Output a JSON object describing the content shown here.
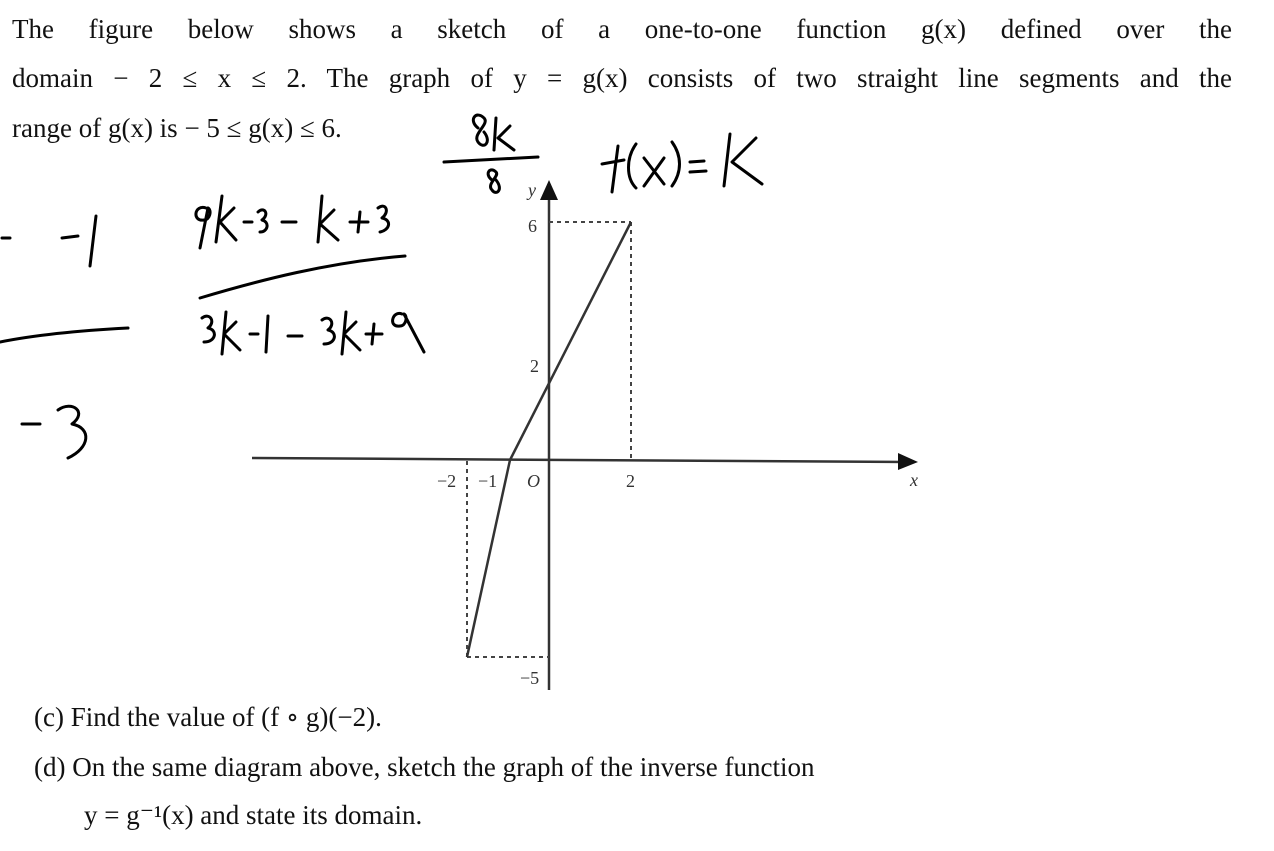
{
  "problem": {
    "intro_line1": "The figure below shows a sketch of a one-to-one function g(x) defined over the",
    "intro_line2": "domain − 2 ≤ x ≤ 2. The graph of y = g(x) consists of two straight line segments and the",
    "intro_line3": "range of g(x) is − 5 ≤ g(x) ≤ 6.",
    "part_c": "(c) Find the value of (f ∘ g)(−2).",
    "part_d_line1": "(d) On the same diagram above, sketch the graph of the inverse function",
    "part_d_line2": "y = g⁻¹(x) and state its domain."
  },
  "figure": {
    "x_axis_label": "x",
    "y_axis_label": "y",
    "origin_label": "O",
    "x_ticks": [
      "−2",
      "−1",
      "2"
    ],
    "y_ticks": [
      "6",
      "2",
      "−5"
    ],
    "segments": [
      {
        "from": [
          -2,
          -5
        ],
        "to": [
          -1,
          0
        ]
      },
      {
        "from": [
          -1,
          0
        ],
        "to": [
          2,
          6
        ]
      }
    ],
    "dashed_guides": [
      {
        "from": [
          -2,
          0
        ],
        "to": [
          -2,
          -5
        ]
      },
      {
        "from": [
          -2,
          -5
        ],
        "to": [
          0,
          -5
        ]
      },
      {
        "from": [
          2,
          0
        ],
        "to": [
          2,
          6
        ]
      },
      {
        "from": [
          0,
          6
        ],
        "to": [
          2,
          6
        ]
      }
    ],
    "domain": [
      -2,
      2
    ],
    "range": [
      -5,
      6
    ]
  },
  "handwriting": {
    "fraction_top": "8k",
    "fraction_bottom": "8",
    "fx_note": "f(x) = k",
    "numerator": "9k-3 - k+3",
    "denominator": "3k-1 - 3k+9",
    "left_top": "-1",
    "left_bottom": "-3"
  }
}
